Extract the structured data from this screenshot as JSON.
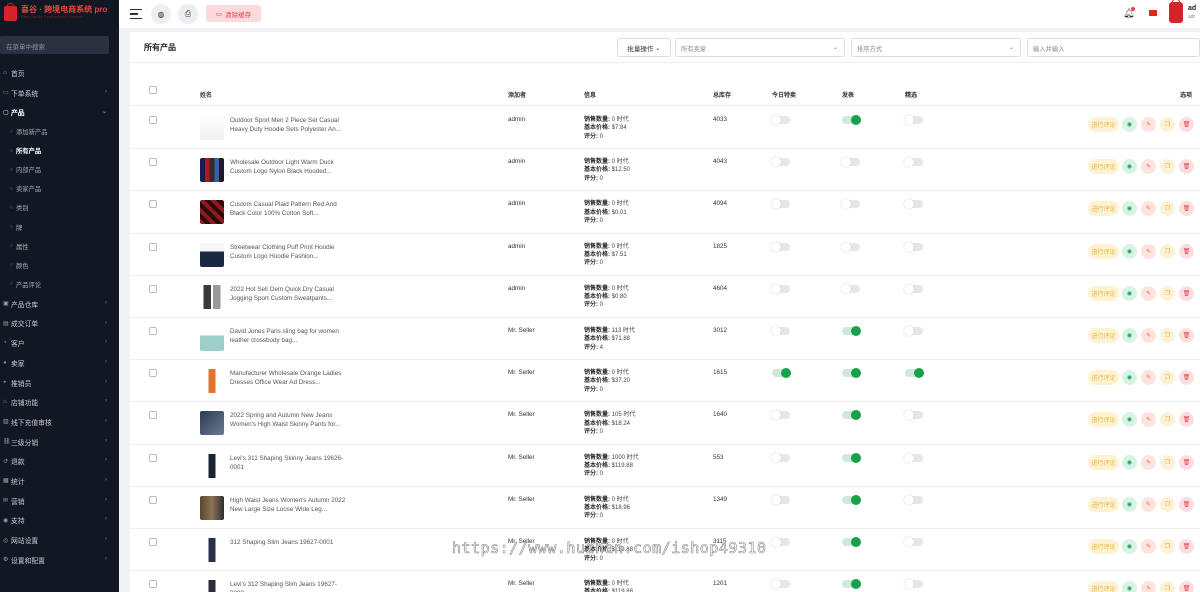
{
  "app": {
    "logo_text": "喜谷 · 跨境电商系统 pro",
    "logo_sub": "Best Seller Ecommerce System"
  },
  "sidebar": {
    "search_placeholder": "在菜单中搜索",
    "items": [
      {
        "label": "首页",
        "icon": "home-icon",
        "has_children": false
      },
      {
        "label": "下单系统",
        "icon": "cart-icon",
        "has_children": true
      },
      {
        "label": "产品",
        "icon": "box-icon",
        "has_children": true,
        "expanded": true,
        "children": [
          {
            "label": "添加新产品"
          },
          {
            "label": "所有产品",
            "active": true
          },
          {
            "label": "内部产品"
          },
          {
            "label": "卖家产品"
          },
          {
            "label": "类别"
          },
          {
            "label": "牌"
          },
          {
            "label": "属性"
          },
          {
            "label": "颜色"
          },
          {
            "label": "产品评论"
          }
        ]
      },
      {
        "label": "产品仓库",
        "icon": "warehouse-icon",
        "has_children": true
      },
      {
        "label": "成交订单",
        "icon": "order-icon",
        "has_children": true
      },
      {
        "label": "客户",
        "icon": "customer-icon",
        "has_children": true
      },
      {
        "label": "卖家",
        "icon": "seller-icon",
        "has_children": true
      },
      {
        "label": "推销员",
        "icon": "promoter-icon",
        "has_children": true
      },
      {
        "label": "店铺功能",
        "icon": "shop-icon",
        "has_children": true
      },
      {
        "label": "线下充值审核",
        "icon": "recharge-icon",
        "has_children": true
      },
      {
        "label": "三级分销",
        "icon": "distribution-icon",
        "has_children": true
      },
      {
        "label": "退款",
        "icon": "refund-icon",
        "has_children": true
      },
      {
        "label": "统计",
        "icon": "stats-icon",
        "has_children": true
      },
      {
        "label": "营销",
        "icon": "marketing-icon",
        "has_children": true
      },
      {
        "label": "支持",
        "icon": "support-icon",
        "has_children": true
      },
      {
        "label": "网站设置",
        "icon": "website-icon",
        "has_children": true
      },
      {
        "label": "设置和配置",
        "icon": "settings-icon",
        "has_children": true
      }
    ]
  },
  "topbar": {
    "clear_cache_label": "清除缓存",
    "user_name": "ad",
    "user_role": "adr"
  },
  "page": {
    "title": "所有产品",
    "bulk_action_label": "批量操作",
    "seller_select": "所有卖家",
    "sort_select": "排序方式",
    "search_placeholder": "输入并输入"
  },
  "table": {
    "columns": {
      "name": "姓名",
      "added_by": "添加者",
      "info": "信息",
      "total_stock": "总库存",
      "todays_deal": "今日特卖",
      "published": "发表",
      "featured": "精选",
      "options": "选项"
    },
    "info_labels": {
      "sales": "销售数量:",
      "price": "基本价格:",
      "rating": "评分:"
    },
    "action_review": "进行评论",
    "rows": [
      {
        "name": "Outdoor Sport Men 2 Piece Set Casual Heavy Duty Hoodie Sets Polyester An...",
        "added_by": "admin",
        "sales": "0 时代",
        "price": "$7.84",
        "rating": "0",
        "stock": "4033",
        "todays_deal": false,
        "published": true,
        "featured": false
      },
      {
        "name": "Wholesale Outdoor Light Warm Duck Custom Logo Nylon Black Hooded...",
        "added_by": "admin",
        "sales": "0 时代",
        "price": "$12.50",
        "rating": "0",
        "stock": "4043",
        "todays_deal": false,
        "published": false,
        "featured": false
      },
      {
        "name": "Custom Casual Plaid Pattern Red And Black Color 100% Cotton Soft...",
        "added_by": "admin",
        "sales": "0 时代",
        "price": "$0.01",
        "rating": "0",
        "stock": "4094",
        "todays_deal": false,
        "published": false,
        "featured": false
      },
      {
        "name": "Streetwear Clothing Puff Print Hoodie Custom Logo Hoodie Fashion...",
        "added_by": "admin",
        "sales": "0 时代",
        "price": "$7.51",
        "rating": "0",
        "stock": "1825",
        "todays_deal": false,
        "published": false,
        "featured": false
      },
      {
        "name": "2022 Hot Sell Oem Quick Dry Casual Jogging Sport Custom Sweatpants...",
        "added_by": "admin",
        "sales": "0 时代",
        "price": "$0.80",
        "rating": "0",
        "stock": "4604",
        "todays_deal": false,
        "published": false,
        "featured": false
      },
      {
        "name": "David Jones Paris sling bag for women leather crossbody bag...",
        "added_by": "Mr. Seller",
        "sales": "113 时代",
        "price": "$71.88",
        "rating": "4",
        "stock": "3012",
        "todays_deal": false,
        "published": true,
        "featured": false
      },
      {
        "name": "Manufacturer Wholesale Orange Ladies Dresses Office Wear Ad Dress...",
        "added_by": "Mr. Seller",
        "sales": "0 时代",
        "price": "$37.20",
        "rating": "0",
        "stock": "1615",
        "todays_deal": true,
        "published": true,
        "featured": true
      },
      {
        "name": "2022 Spring and Autumn New Jeans Women's High Waist Skinny Pants for...",
        "added_by": "Mr. Seller",
        "sales": "105 时代",
        "price": "$18.24",
        "rating": "0",
        "stock": "1640",
        "todays_deal": false,
        "published": true,
        "featured": false
      },
      {
        "name": "Levi's 311 Shaping Skinny Jeans 19626-0001",
        "added_by": "Mr. Seller",
        "sales": "1000 时代",
        "price": "$119.88",
        "rating": "0",
        "stock": "553",
        "todays_deal": false,
        "published": true,
        "featured": false
      },
      {
        "name": "High Waist Jeans Women's Autumn 2022 New Large Size Loose Wide Leg...",
        "added_by": "Mr. Seller",
        "sales": "0 时代",
        "price": "$18.96",
        "rating": "0",
        "stock": "1349",
        "todays_deal": false,
        "published": true,
        "featured": false
      },
      {
        "name": "312 Shaping Slim Jeans 19627-0001",
        "added_by": "Mr. Seller",
        "sales": "0 时代",
        "price": "$119.88",
        "rating": "0",
        "stock": "3115",
        "todays_deal": false,
        "published": true,
        "featured": false
      },
      {
        "name": "Levi's 312 Shaping Slim Jeans 19627-0000",
        "added_by": "Mr. Seller",
        "sales": "0 时代",
        "price": "$119.88",
        "rating": "0",
        "stock": "1201",
        "todays_deal": false,
        "published": true,
        "featured": false
      }
    ]
  },
  "watermark": "https://www.huzhan.com/ishop49310",
  "colors": {
    "sidebar_bg": "#111723",
    "accent_green": "#19a04b",
    "danger": "#e2434f",
    "warning": "#e8b034"
  }
}
